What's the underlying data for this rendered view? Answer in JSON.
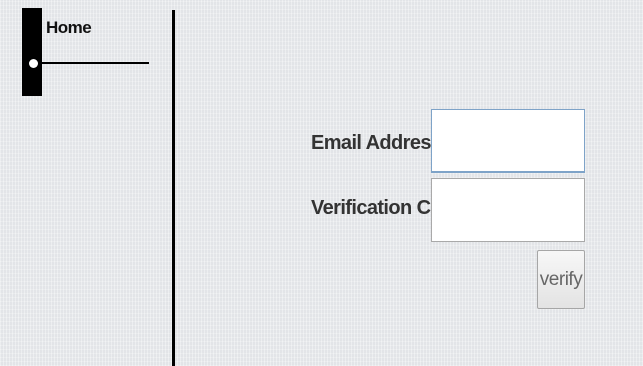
{
  "nav": {
    "home_label": "Home"
  },
  "form": {
    "email_label": "Email Address:",
    "email_value": "",
    "code_label": "Verification Code:",
    "code_value": "",
    "verify_label": "verify"
  },
  "colors": {
    "background": "#e9ebee",
    "divider": "#000000",
    "email_field_border": "#7ea3c8"
  }
}
